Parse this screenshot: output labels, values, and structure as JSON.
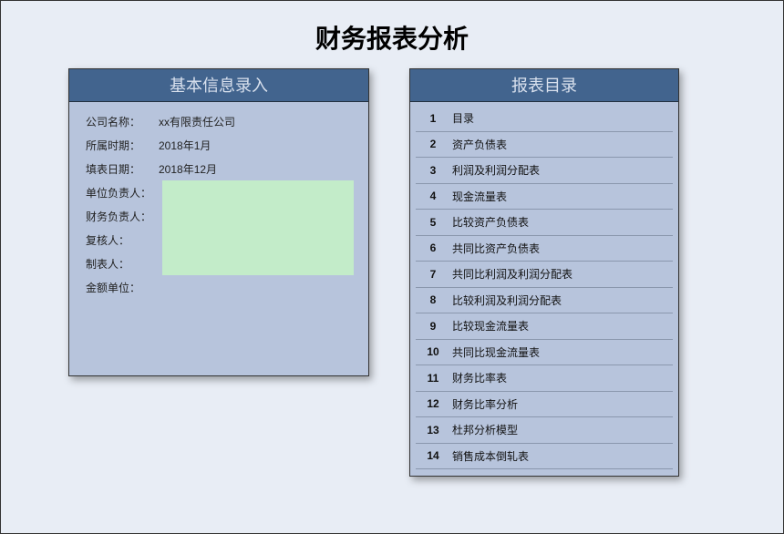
{
  "title": "财务报表分析",
  "left": {
    "header": "基本信息录入",
    "rows": [
      {
        "label": "公司名称：",
        "value": "xx有限责任公司"
      },
      {
        "label": "所属时期：",
        "value": "2018年1月"
      },
      {
        "label": "填表日期：",
        "value": "2018年12月"
      },
      {
        "label": "单位负责人：",
        "value": ""
      },
      {
        "label": "财务负责人：",
        "value": ""
      },
      {
        "label": "复核人：",
        "value": ""
      },
      {
        "label": "制表人：",
        "value": ""
      },
      {
        "label": "金额单位：",
        "value": ""
      }
    ]
  },
  "right": {
    "header": "报表目录",
    "items": [
      {
        "num": "1",
        "label": "目录"
      },
      {
        "num": "2",
        "label": "资产负债表"
      },
      {
        "num": "3",
        "label": "利润及利润分配表"
      },
      {
        "num": "4",
        "label": "现金流量表"
      },
      {
        "num": "5",
        "label": "比较资产负债表"
      },
      {
        "num": "6",
        "label": "共同比资产负债表"
      },
      {
        "num": "7",
        "label": "共同比利润及利润分配表"
      },
      {
        "num": "8",
        "label": "比较利润及利润分配表"
      },
      {
        "num": "9",
        "label": "比较现金流量表"
      },
      {
        "num": "10",
        "label": "共同比现金流量表"
      },
      {
        "num": "11",
        "label": "财务比率表"
      },
      {
        "num": "12",
        "label": "财务比率分析"
      },
      {
        "num": "13",
        "label": "杜邦分析模型"
      },
      {
        "num": "14",
        "label": "销售成本倒轧表"
      }
    ]
  }
}
